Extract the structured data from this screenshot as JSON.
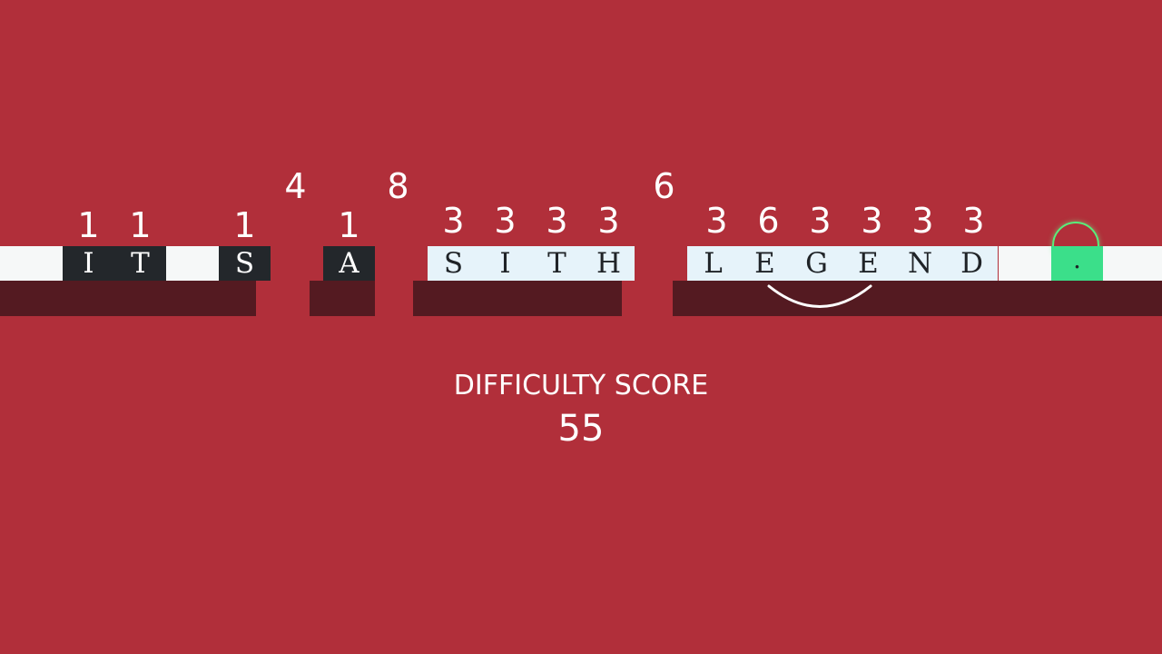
{
  "colors": {
    "background": "#b12f3a",
    "track": "#f6f8f8",
    "shadow": "#541a21",
    "tile_dark": "#23272b",
    "tile_light": "#e6f3fa",
    "lock_green": "#3bdf8a",
    "lock_ring": "#58ee7b"
  },
  "tiles": [
    {
      "char": "I",
      "number": "1",
      "style": "dark"
    },
    {
      "char": "T",
      "number": "1",
      "style": "dark"
    },
    {
      "char": "S",
      "number": "1",
      "style": "dark"
    },
    {
      "char": "A",
      "number": "1",
      "style": "dark"
    },
    {
      "char": "S",
      "number": "3",
      "style": "light"
    },
    {
      "char": "I",
      "number": "3",
      "style": "light"
    },
    {
      "char": "T",
      "number": "3",
      "style": "light"
    },
    {
      "char": "H",
      "number": "3",
      "style": "light"
    },
    {
      "char": "L",
      "number": "3",
      "style": "light"
    },
    {
      "char": "E",
      "number": "6",
      "style": "light"
    },
    {
      "char": "G",
      "number": "3",
      "style": "light"
    },
    {
      "char": "E",
      "number": "3",
      "style": "light"
    },
    {
      "char": "N",
      "number": "3",
      "style": "light"
    },
    {
      "char": "D",
      "number": "3",
      "style": "light"
    },
    {
      "char": ".",
      "number": "",
      "style": "green",
      "icon": "lock-icon"
    }
  ],
  "gap_numbers": [
    "4",
    "8",
    "6"
  ],
  "score": {
    "label": "DIFFICULTY SCORE",
    "value": "55"
  }
}
